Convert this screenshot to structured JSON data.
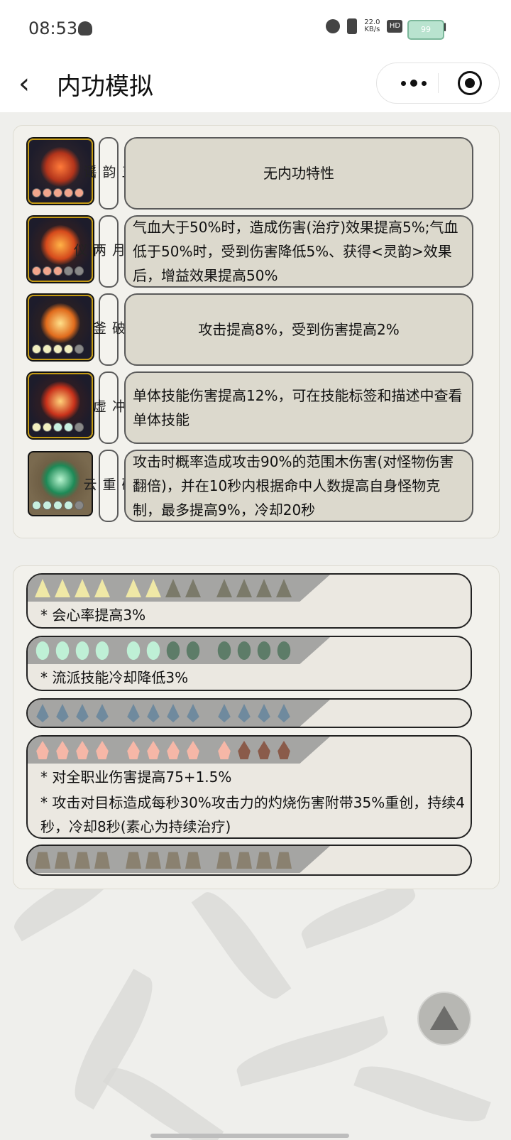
{
  "status_bar": {
    "time": "08:53",
    "net_speed": "22.0",
    "net_unit": "KB/s",
    "hd": "HD",
    "signal": "5G",
    "battery": "99"
  },
  "nav": {
    "back_icon": "chevron-left-icon",
    "title": "内功模拟",
    "more_icon": "more-dots-icon",
    "close_icon": "target-close-icon"
  },
  "skills": [
    {
      "name": "五\n韵\n谣",
      "icon": "fire-swirl-icon",
      "description": "无内功特性",
      "element": "fire",
      "stars": [
        "fire",
        "fire",
        "fire",
        "fire",
        "fire"
      ]
    },
    {
      "name": "日\n月\n两\n仪",
      "icon": "sun-moon-icon",
      "description": "气血大于50%时，造成伤害(治疗)效果提高5%;气血低于50%时，受到伤害降低5%、获得<灵韵>效果后，增益效果提高50%",
      "element": "fire",
      "stars": [
        "fire",
        "fire",
        "fire",
        "q",
        "q"
      ]
    },
    {
      "name": "破\n釜",
      "icon": "flame-blade-icon",
      "description": "攻击提高8%，受到伤害提高2%",
      "element": "metal",
      "stars": [
        "gold2",
        "gold2",
        "gold2",
        "gold2",
        "q"
      ]
    },
    {
      "name": "冲\n虚",
      "icon": "fire-sun-icon",
      "description": "单体技能伤害提高12%，可在技能标签和描述中查看单体技能",
      "element": "mixed",
      "stars": [
        "gold2",
        "gold2",
        "wood",
        "wood",
        "q"
      ]
    },
    {
      "name": "破\n重\n云",
      "icon": "green-leaf-orb-icon",
      "description": "攻击时概率造成攻击90%的范围木伤害(对怪物伤害翻倍)，并在10秒内根据命中人数提高自身怪物克制，最多提高9%，冷却20秒",
      "element": "wood",
      "stars": [
        "wood",
        "wood",
        "wood",
        "wood",
        "q"
      ]
    }
  ],
  "elements": [
    {
      "type": "metal",
      "lines": [
        "* 会心率提高3%"
      ]
    },
    {
      "type": "wood",
      "lines": [
        "* 流派技能冷却降低3%"
      ]
    },
    {
      "type": "water",
      "lines": []
    },
    {
      "type": "fire",
      "lines": [
        "* 对全职业伤害提高75+1.5%",
        "* 攻击对目标造成每秒30%攻击力的灼烧伤害附带35%重创，持续4秒，冷却8秒(素心为持续治疗)"
      ]
    },
    {
      "type": "earth",
      "lines": []
    }
  ],
  "scroll_top_icon": "triangle-up-icon"
}
